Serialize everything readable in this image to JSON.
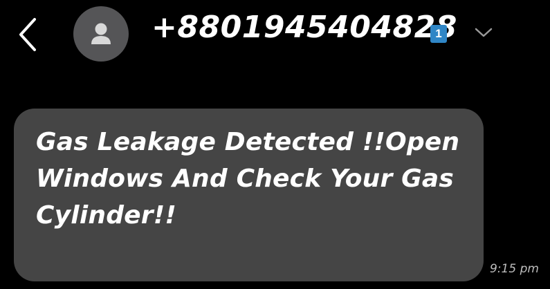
{
  "header": {
    "back_icon": "chevron-left-icon",
    "avatar_icon": "person-icon",
    "phone_number": "+8801945404828",
    "sim_badge": "1",
    "sim_badge_color": "#2f86c6",
    "expand_icon": "chevron-down-icon"
  },
  "message": {
    "text": "Gas Leakage Detected !!Open Windows And Check Your Gas Cylinder!!",
    "time": "9:15 pm",
    "bubble_color": "#454545"
  }
}
